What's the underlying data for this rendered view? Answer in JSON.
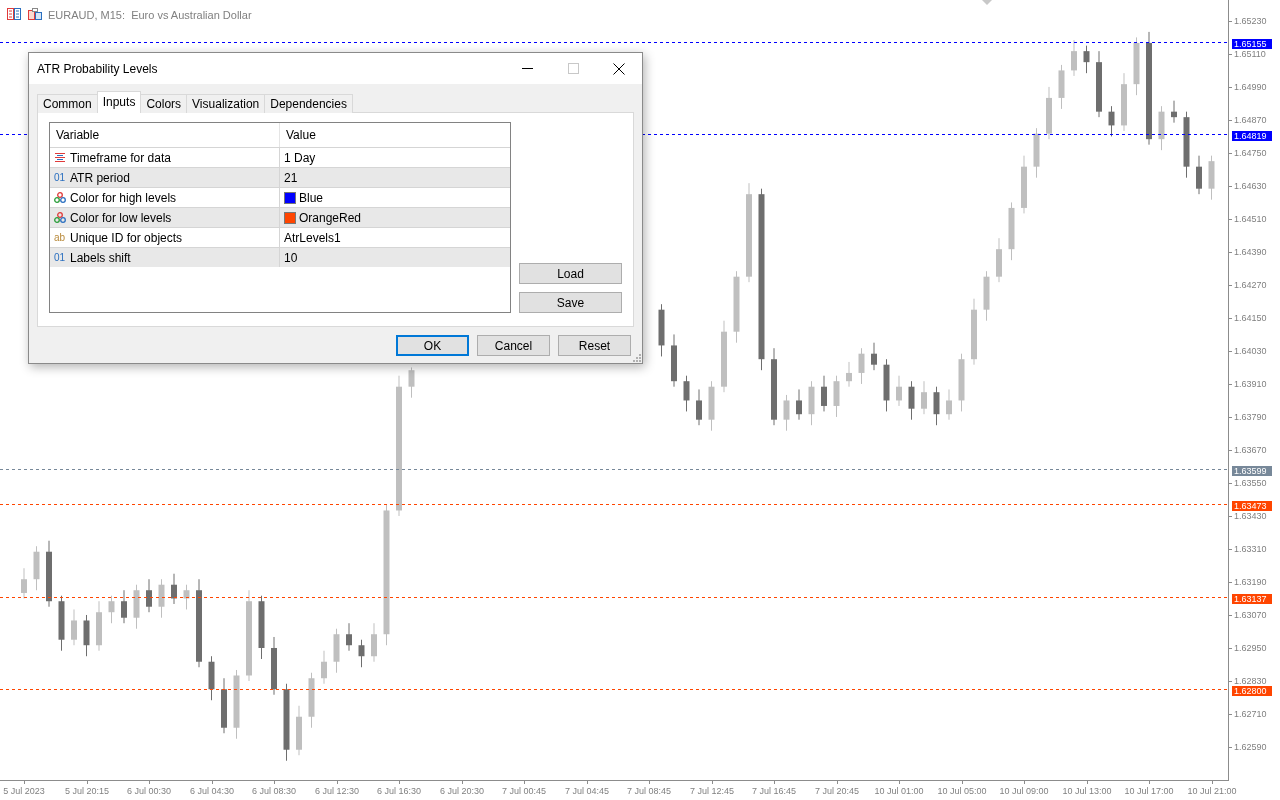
{
  "chart_window": {
    "title": "EURAUD, M15:  Euro vs Australian Dollar",
    "chart_data": {
      "type": "candlestick",
      "ylim": [
        1.6247,
        1.65306
      ],
      "categories": [
        "5 Jul 2023",
        null,
        null,
        null,
        null,
        "5 Jul 20:15",
        null,
        null,
        null,
        null,
        "6 Jul 00:30",
        null,
        null,
        null,
        null,
        "6 Jul 04:30",
        null,
        null,
        null,
        null,
        "6 Jul 08:30",
        null,
        null,
        null,
        null,
        "6 Jul 12:30",
        null,
        null,
        null,
        null,
        "6 Jul 16:30",
        null,
        null,
        null,
        null,
        "6 Jul 20:30",
        null,
        null,
        null,
        null,
        "7 Jul 00:45",
        null,
        null,
        null,
        null,
        "7 Jul 04:45",
        null,
        null,
        null,
        null,
        "7 Jul 08:45",
        null,
        null,
        null,
        null,
        "7 Jul 12:45",
        null,
        null,
        null,
        null,
        "7 Jul 16:45",
        null,
        null,
        null,
        null,
        "7 Jul 20:45",
        null,
        null,
        null,
        null,
        "10 Jul 01:00",
        null,
        null,
        null,
        null,
        "10 Jul 05:00",
        null,
        null,
        null,
        null,
        "10 Jul 09:00",
        null,
        null,
        null,
        null,
        "10 Jul 13:00",
        null,
        null,
        null,
        null,
        "10 Jul 17:00",
        null,
        null,
        null,
        null,
        "10 Jul 21:00"
      ],
      "ohlc": [
        [
          1.6315,
          1.6324,
          1.6313,
          1.632
        ],
        [
          1.632,
          1.6332,
          1.6316,
          1.633
        ],
        [
          1.633,
          1.6334,
          1.631,
          1.6312
        ],
        [
          1.6312,
          1.6314,
          1.6294,
          1.6298
        ],
        [
          1.6298,
          1.6309,
          1.6296,
          1.6305
        ],
        [
          1.6305,
          1.6307,
          1.6292,
          1.6296
        ],
        [
          1.6296,
          1.6312,
          1.6294,
          1.6308
        ],
        [
          1.6308,
          1.6314,
          1.6304,
          1.6312
        ],
        [
          1.6312,
          1.6316,
          1.6304,
          1.6306
        ],
        [
          1.6306,
          1.6318,
          1.6302,
          1.6316
        ],
        [
          1.6316,
          1.632,
          1.6308,
          1.631
        ],
        [
          1.631,
          1.632,
          1.6306,
          1.6318
        ],
        [
          1.6318,
          1.6322,
          1.6311,
          1.6313
        ],
        [
          1.6313,
          1.6318,
          1.6309,
          1.6316
        ],
        [
          1.6316,
          1.632,
          1.6288,
          1.629
        ],
        [
          1.629,
          1.6292,
          1.6276,
          1.628
        ],
        [
          1.628,
          1.6284,
          1.6264,
          1.6266
        ],
        [
          1.6266,
          1.6287,
          1.6262,
          1.6285
        ],
        [
          1.6285,
          1.6316,
          1.6283,
          1.6312
        ],
        [
          1.6312,
          1.6314,
          1.6291,
          1.6295
        ],
        [
          1.6295,
          1.6299,
          1.6278,
          1.628
        ],
        [
          1.628,
          1.6282,
          1.6254,
          1.6258
        ],
        [
          1.6258,
          1.6274,
          1.6256,
          1.627
        ],
        [
          1.627,
          1.6286,
          1.6266,
          1.6284
        ],
        [
          1.6284,
          1.6294,
          1.6282,
          1.629
        ],
        [
          1.629,
          1.6302,
          1.6286,
          1.63
        ],
        [
          1.63,
          1.6304,
          1.6294,
          1.6296
        ],
        [
          1.6296,
          1.6298,
          1.6288,
          1.6292
        ],
        [
          1.6292,
          1.6304,
          1.629,
          1.63
        ],
        [
          1.63,
          1.6347,
          1.6296,
          1.6345
        ],
        [
          1.6345,
          1.6394,
          1.6343,
          1.639
        ],
        [
          1.639,
          1.6397,
          1.6386,
          1.6396
        ],
        null,
        null,
        null,
        null,
        null,
        null,
        null,
        null,
        null,
        null,
        null,
        null,
        null,
        null,
        null,
        null,
        null,
        null,
        null,
        [
          1.6418,
          1.642,
          1.6401,
          1.6405
        ],
        [
          1.6405,
          1.6409,
          1.639,
          1.6392
        ],
        [
          1.6392,
          1.6394,
          1.6381,
          1.6385
        ],
        [
          1.6385,
          1.6389,
          1.6376,
          1.6378
        ],
        [
          1.6378,
          1.6392,
          1.6374,
          1.639
        ],
        [
          1.639,
          1.6414,
          1.6388,
          1.641
        ],
        [
          1.641,
          1.6432,
          1.6406,
          1.643
        ],
        [
          1.643,
          1.6464,
          1.6428,
          1.646
        ],
        [
          1.646,
          1.6462,
          1.6396,
          1.64
        ],
        [
          1.64,
          1.6404,
          1.6376,
          1.6378
        ],
        [
          1.6378,
          1.6387,
          1.6374,
          1.6385
        ],
        [
          1.6385,
          1.6389,
          1.6378,
          1.638
        ],
        [
          1.638,
          1.6392,
          1.6376,
          1.639
        ],
        [
          1.639,
          1.6394,
          1.6381,
          1.6383
        ],
        [
          1.6383,
          1.6394,
          1.6379,
          1.6392
        ],
        [
          1.6392,
          1.6399,
          1.639,
          1.6395
        ],
        [
          1.6395,
          1.6404,
          1.6391,
          1.6402
        ],
        [
          1.6402,
          1.6406,
          1.6396,
          1.6398
        ],
        [
          1.6398,
          1.64,
          1.6381,
          1.6385
        ],
        [
          1.6385,
          1.6394,
          1.6383,
          1.639
        ],
        [
          1.639,
          1.6392,
          1.6378,
          1.6382
        ],
        [
          1.6382,
          1.6392,
          1.638,
          1.6388
        ],
        [
          1.6388,
          1.639,
          1.6376,
          1.638
        ],
        [
          1.638,
          1.6389,
          1.6378,
          1.6385
        ],
        [
          1.6385,
          1.6402,
          1.6381,
          1.64
        ],
        [
          1.64,
          1.6422,
          1.6398,
          1.6418
        ],
        [
          1.6418,
          1.6432,
          1.6414,
          1.643
        ],
        [
          1.643,
          1.6444,
          1.6428,
          1.644
        ],
        [
          1.644,
          1.6457,
          1.6436,
          1.6455
        ],
        [
          1.6455,
          1.6474,
          1.6453,
          1.647
        ],
        [
          1.647,
          1.6484,
          1.6466,
          1.6482
        ],
        [
          1.6482,
          1.6499,
          1.648,
          1.6495
        ],
        [
          1.6495,
          1.6507,
          1.6491,
          1.6505
        ],
        [
          1.6505,
          1.6516,
          1.6503,
          1.6512
        ],
        [
          1.6512,
          1.6514,
          1.6504,
          1.6508
        ],
        [
          1.6508,
          1.6512,
          1.6488,
          1.649
        ],
        [
          1.649,
          1.6492,
          1.6481,
          1.6485
        ],
        [
          1.6485,
          1.6504,
          1.6483,
          1.65
        ],
        [
          1.65,
          1.6517,
          1.6496,
          1.6515
        ],
        [
          1.6515,
          1.6519,
          1.6478,
          1.648
        ],
        [
          1.648,
          1.6492,
          1.6476,
          1.649
        ],
        [
          1.649,
          1.6494,
          1.6486,
          1.6488
        ],
        [
          1.6488,
          1.649,
          1.6466,
          1.647
        ],
        [
          1.647,
          1.6474,
          1.646,
          1.6462
        ],
        [
          1.6462,
          1.6474,
          1.6458,
          1.6472
        ]
      ],
      "yticks": [
        {
          "value": 1.6523,
          "label": "1.65230"
        },
        {
          "value": 1.6511,
          "label": "1.65110"
        },
        {
          "value": 1.6499,
          "label": "1.64990"
        },
        {
          "value": 1.6487,
          "label": "1.64870"
        },
        {
          "value": 1.6475,
          "label": "1.64750"
        },
        {
          "value": 1.6463,
          "label": "1.64630"
        },
        {
          "value": 1.6451,
          "label": "1.64510"
        },
        {
          "value": 1.6439,
          "label": "1.64390"
        },
        {
          "value": 1.6427,
          "label": "1.64270"
        },
        {
          "value": 1.6415,
          "label": "1.64150"
        },
        {
          "value": 1.6403,
          "label": "1.64030"
        },
        {
          "value": 1.6391,
          "label": "1.63910"
        },
        {
          "value": 1.6379,
          "label": "1.63790"
        },
        {
          "value": 1.6367,
          "label": "1.63670"
        },
        {
          "value": 1.6355,
          "label": "1.63550"
        },
        {
          "value": 1.6343,
          "label": "1.63430"
        },
        {
          "value": 1.6331,
          "label": "1.63310"
        },
        {
          "value": 1.6319,
          "label": "1.63190"
        },
        {
          "value": 1.6307,
          "label": "1.63070"
        },
        {
          "value": 1.6295,
          "label": "1.62950"
        },
        {
          "value": 1.6283,
          "label": "1.62830"
        },
        {
          "value": 1.6271,
          "label": "1.62710"
        },
        {
          "value": 1.6259,
          "label": "1.62590"
        }
      ],
      "ref_lines": [
        {
          "axis": "y",
          "value": 1.65155,
          "label": "1.65155",
          "color": "#0000ff"
        },
        {
          "axis": "y",
          "value": 1.64819,
          "label": "1.64819",
          "color": "#0000ff"
        },
        {
          "axis": "y",
          "value": 1.63599,
          "label": "1.63599",
          "color": "#778899"
        },
        {
          "axis": "y",
          "value": 1.63473,
          "label": "1.63473",
          "color": "#ff4500"
        },
        {
          "axis": "y",
          "value": 1.63137,
          "label": "1.63137",
          "color": "#ff4500"
        },
        {
          "axis": "y",
          "value": 1.628,
          "label": "1.62800",
          "color": "#ff4500"
        }
      ]
    }
  },
  "dialog": {
    "title": "ATR Probability Levels",
    "tabs": [
      {
        "label": "Common",
        "selected": false
      },
      {
        "label": "Inputs",
        "selected": true
      },
      {
        "label": "Colors",
        "selected": false
      },
      {
        "label": "Visualization",
        "selected": false
      },
      {
        "label": "Dependencies",
        "selected": false
      }
    ],
    "columns": [
      "Variable",
      "Value"
    ],
    "rows": [
      {
        "kind": "timeframe",
        "variable": "Timeframe for data",
        "value": "1 Day"
      },
      {
        "kind": "number",
        "icon_text": "01",
        "variable": "ATR period",
        "value": "21"
      },
      {
        "kind": "color",
        "variable": "Color for high levels",
        "value": "Blue",
        "color": "#0000ff"
      },
      {
        "kind": "color",
        "variable": "Color for low levels",
        "value": "OrangeRed",
        "color": "#ff4500"
      },
      {
        "kind": "string",
        "icon_text": "ab",
        "variable": "Unique ID for objects",
        "value": "AtrLevels1"
      },
      {
        "kind": "number",
        "icon_text": "01",
        "variable": "Labels shift",
        "value": "10"
      }
    ],
    "side_buttons": [
      "Load",
      "Save"
    ],
    "buttons": [
      {
        "label": "OK",
        "default": true
      },
      {
        "label": "Cancel",
        "default": false
      },
      {
        "label": "Reset",
        "default": false
      }
    ]
  }
}
